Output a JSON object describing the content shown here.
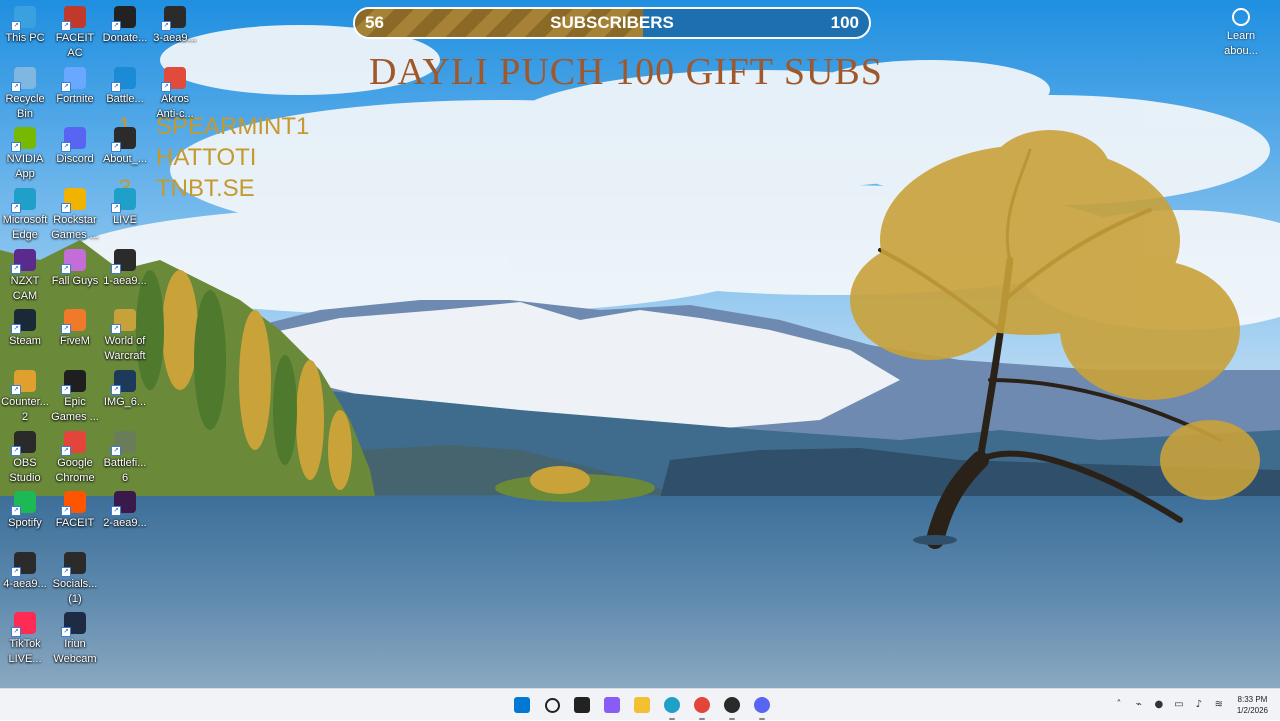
{
  "desktop": {
    "icons": [
      {
        "label": "This PC",
        "icon": "monitor-icon",
        "color": "#3aa0e0"
      },
      {
        "label": "FACEIT AC",
        "icon": "faceit-ac-icon",
        "color": "#c0392b"
      },
      {
        "label": "Donate...",
        "icon": "donate-icon",
        "color": "#222222"
      },
      {
        "label": "3-aea9...",
        "icon": "image-file-icon",
        "color": "#2b2b2b"
      },
      {
        "label": "Recycle Bin",
        "icon": "recycle-bin-icon",
        "color": "#7fb7e0"
      },
      {
        "label": "Fortnite",
        "icon": "fortnite-icon",
        "color": "#6aa8ff"
      },
      {
        "label": "Battle...",
        "icon": "battlenet-icon",
        "color": "#1b8bd6"
      },
      {
        "label": "Akros Anti-c...",
        "icon": "akros-icon",
        "color": "#e24a3b"
      },
      {
        "label": "NVIDIA App",
        "icon": "nvidia-icon",
        "color": "#76b900"
      },
      {
        "label": "Discord",
        "icon": "discord-icon",
        "color": "#5865f2"
      },
      {
        "label": "About_...",
        "icon": "about-file-icon",
        "color": "#2b2b2b"
      },
      {
        "label": "Microsoft Edge",
        "icon": "edge-icon",
        "color": "#1fa0c8"
      },
      {
        "label": "Rockstar Games ...",
        "icon": "rockstar-icon",
        "color": "#f0b400"
      },
      {
        "label": "LIVE",
        "icon": "edge-live-icon",
        "color": "#1fa0c8"
      },
      {
        "label": "NZXT CAM",
        "icon": "nzxt-icon",
        "color": "#5a2a8c"
      },
      {
        "label": "Fall Guys",
        "icon": "fallguys-icon",
        "color": "#c46cd8"
      },
      {
        "label": "1-aea9...",
        "icon": "donate-file-icon",
        "color": "#2b2b2b"
      },
      {
        "label": "Steam",
        "icon": "steam-icon",
        "color": "#1b2838"
      },
      {
        "label": "FiveM",
        "icon": "fivem-icon",
        "color": "#f07a2a"
      },
      {
        "label": "World of Warcraft",
        "icon": "wow-icon",
        "color": "#c7a23a"
      },
      {
        "label": "Counter... 2",
        "icon": "cs2-icon",
        "color": "#e0a030"
      },
      {
        "label": "Epic Games ...",
        "icon": "epic-icon",
        "color": "#1f1f1f"
      },
      {
        "label": "IMG_6...",
        "icon": "image-file-icon",
        "color": "#1e3a5a"
      },
      {
        "label": "OBS Studio",
        "icon": "obs-icon",
        "color": "#2a2a2a"
      },
      {
        "label": "Google Chrome",
        "icon": "chrome-icon",
        "color": "#e4453a"
      },
      {
        "label": "Battlefi... 6",
        "icon": "battlefield-icon",
        "color": "#6a7c5a"
      },
      {
        "label": "Spotify",
        "icon": "spotify-icon",
        "color": "#1db954"
      },
      {
        "label": "FACEIT",
        "icon": "faceit-icon",
        "color": "#ff5500"
      },
      {
        "label": "2-aea9...",
        "icon": "image-file-icon",
        "color": "#3a1a4a"
      },
      {
        "label": "4-aea9...",
        "icon": "socials-file-icon",
        "color": "#2b2b2b"
      },
      {
        "label": "Socials... (1)",
        "icon": "socials-file-icon",
        "color": "#2b2b2b"
      },
      {
        "label": "TikTok LIVE...",
        "icon": "tiktok-icon",
        "color": "#fe2c55"
      },
      {
        "label": "Iriun Webcam",
        "icon": "webcam-icon",
        "color": "#1f2b45"
      }
    ],
    "learn_about": {
      "label": "Learn abou..."
    }
  },
  "overlay": {
    "subscriber_bar": {
      "current": "56",
      "goal": "100",
      "title": "SUBSCRIBERS",
      "progress": 0.56
    },
    "headline": "DAYLI  PUCH 100 GIFT SUBS",
    "leaderboard": [
      {
        "rank": "1",
        "name": "SPEARMINT1"
      },
      {
        "rank": "",
        "name": "HATTOTI"
      },
      {
        "rank": "3",
        "name": "TNBT.SE"
      }
    ]
  },
  "taskbar": {
    "apps": [
      {
        "icon": "windows-start-icon",
        "color": "#0078d4"
      },
      {
        "icon": "search-icon",
        "color": "#222222"
      },
      {
        "icon": "task-view-icon",
        "color": "#222222"
      },
      {
        "icon": "copilot-icon",
        "color": "#8a5cf6"
      },
      {
        "icon": "file-explorer-icon",
        "color": "#f2c031"
      },
      {
        "icon": "edge-icon",
        "color": "#1fa0c8"
      },
      {
        "icon": "chrome-icon",
        "color": "#e4453a"
      },
      {
        "icon": "obs-icon",
        "color": "#2a2a2a"
      },
      {
        "icon": "discord-icon",
        "color": "#5865f2"
      }
    ],
    "clock": {
      "time": "8:33 PM",
      "date": "1/2/2026"
    }
  }
}
